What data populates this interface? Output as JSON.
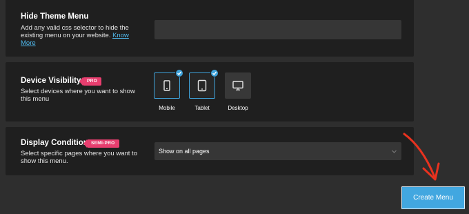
{
  "hide_theme_menu": {
    "title": "Hide Theme Menu",
    "description": "Add any valid css selector to hide the existing menu on your website.",
    "link_label": "Know More",
    "input_value": ""
  },
  "device_visibility": {
    "title": "Device Visibility",
    "badge": "PRO",
    "description": "Select devices where you want to show this menu",
    "devices": [
      {
        "label": "Mobile",
        "selected": true,
        "icon": "mobile-icon"
      },
      {
        "label": "Tablet",
        "selected": true,
        "icon": "tablet-icon"
      },
      {
        "label": "Desktop",
        "selected": false,
        "icon": "desktop-icon"
      }
    ]
  },
  "display_condition": {
    "title": "Display Condition",
    "badge": "SEMI-PRO",
    "description": "Select specific pages where you want to show this menu.",
    "select_value": "Show on all pages"
  },
  "create_button": {
    "label": "Create Menu"
  },
  "colors": {
    "accent": "#42a7e0",
    "badge": "#e83e6f",
    "arrow": "#e8321f",
    "panel": "#1f1f1f",
    "background": "#2e2e2e"
  }
}
